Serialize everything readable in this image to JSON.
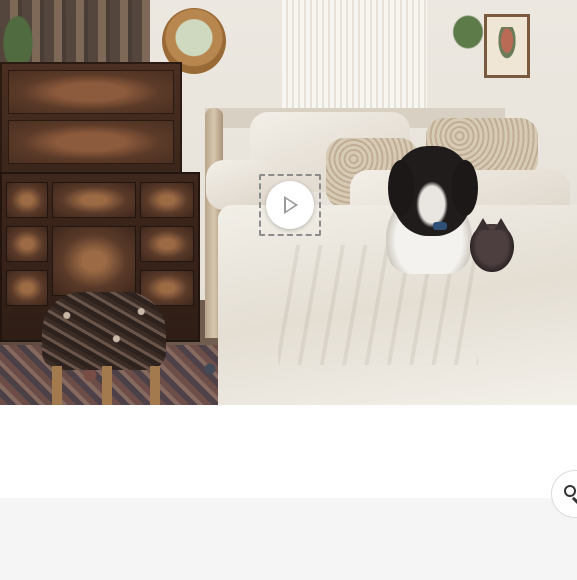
{
  "media": {
    "kind": "video-thumbnail",
    "scene": "bedroom-with-dog-and-cat",
    "play_icon": "play-icon",
    "play_state": "paused"
  },
  "search": {
    "icon": "search-icon"
  },
  "colors": {
    "play_button_bg": "#ffffff",
    "play_icon": "#9a9a9a",
    "focus_outline": "#8c8c8c",
    "bottom_bar": "#f5f5f5",
    "page_bg": "#ffffff"
  }
}
